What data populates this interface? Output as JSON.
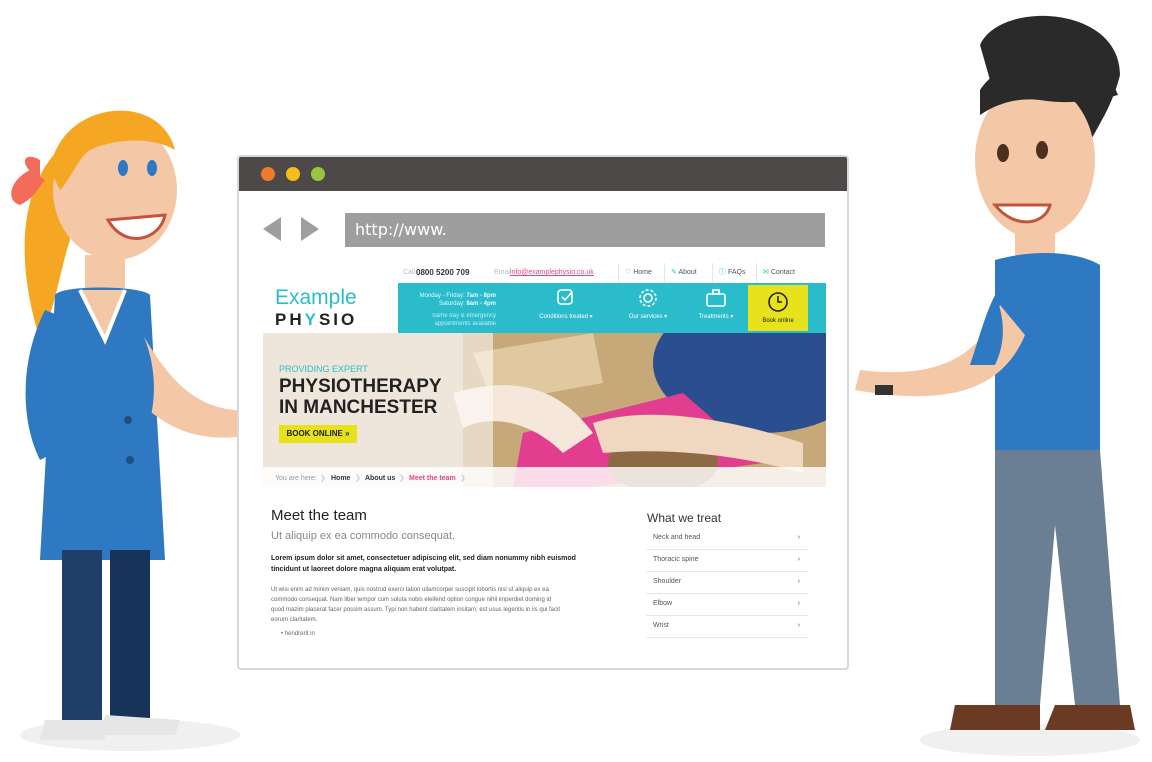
{
  "browser": {
    "url_text": "http://www.",
    "dot_colors": [
      "#f07a2b",
      "#f6bd1c",
      "#9bc43d"
    ]
  },
  "site": {
    "top": {
      "call_label": "Call",
      "phone": "0800 5200 709",
      "email_label": "Email",
      "email": "info@examplephysio.co.uk",
      "links": [
        "Home",
        "About",
        "FAQs",
        "Contact"
      ]
    },
    "logo": {
      "line1": "Example",
      "line2_a": "PH",
      "line2_b": "SIO"
    },
    "hours": {
      "weekday_label": "Monday - Friday:",
      "weekday_value": "7am - 8pm",
      "saturday_label": "Saturday:",
      "saturday_value": "9am - 4pm",
      "note_line1": "Same day & emergency",
      "note_line2": "appointments available"
    },
    "services": [
      "Conditions treated",
      "Our services",
      "Treatments"
    ],
    "book_label": "Book online",
    "hero": {
      "kicker": "PROVIDING EXPERT",
      "title_line1": "PHYSIOTHERAPY",
      "title_line2": "IN MANCHESTER",
      "cta": "BOOK ONLINE »"
    },
    "breadcrumb": {
      "you_are_here": "You are here:",
      "items": [
        "Home",
        "About us",
        "Meet the team"
      ]
    },
    "main": {
      "heading": "Meet the team",
      "subheading": "Ut aliquip ex ea commodo consequat.",
      "lead_line1": "Lorem ipsum dolor sit amet, consectetuer adipiscing elit, sed diam nonummy nibh euismod",
      "lead_line2": "tincidunt ut laoreet dolore magna aliquam erat volutpat.",
      "body_line1": "Ut wisi enim ad minim veniam, quis nostrud exerci tation ullamcorper suscipit lobortis nisl ut aliquip ex ea",
      "body_line2": "commodo consequat. Nam liber tempor cum soluta nobis eleifend option congue nihil imperdiet doming id",
      "body_line3": "quod mazim placerat facer possim assum. Typi non habent claritatem insitam; est usus legentis in iis qui facit",
      "body_line4": "eorum claritatem.",
      "bullet": "hendrerit in"
    },
    "sidebar": {
      "title": "What we treat",
      "items": [
        "Neck and head",
        "Thoracic spine",
        "Shoulder",
        "Elbow",
        "Wrist"
      ]
    }
  },
  "colors": {
    "teal": "#2bbccc",
    "yellow": "#e7e21b",
    "pink": "#e8457f",
    "dark": "#4e4949"
  }
}
